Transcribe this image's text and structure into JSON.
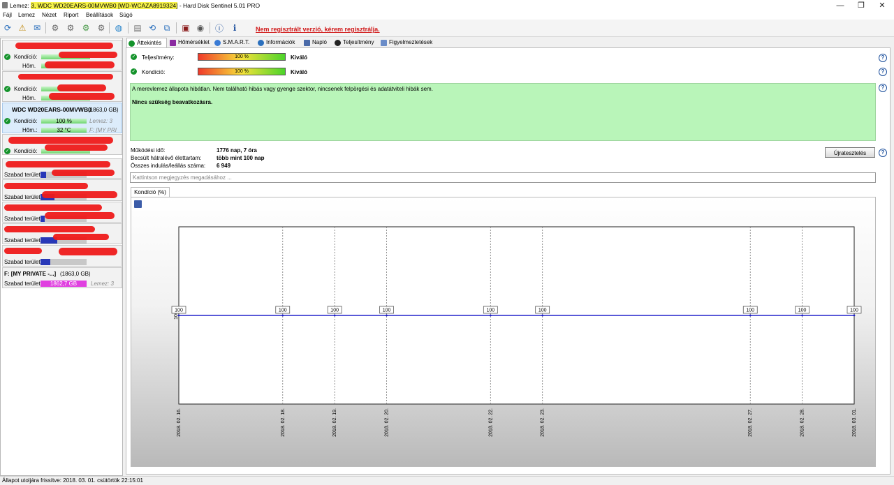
{
  "window": {
    "title_prefix": "Lemez: ",
    "title_disk": "3, WDC WD20EARS-00MVWB0 [WD-WCAZA8919324]",
    "title_app": " -  Hard Disk Sentinel 5.01 PRO",
    "min": "—",
    "max": "❐",
    "close": "✕"
  },
  "menu": [
    "Fájl",
    "Lemez",
    "Nézet",
    "Riport",
    "Beállítások",
    "Súgó"
  ],
  "toolbar": {
    "unregistered": "Nem regisztrált verzió, kérem regisztrálja."
  },
  "left": {
    "disks": [
      {
        "k_label": "Kondíció:",
        "h_label": "Hőm."
      },
      {
        "k_label": "Kondíció:",
        "h_label": "Hőm."
      },
      {
        "name": "WDC WD20EARS-00MVWB0",
        "size": "(1863,0 GB)",
        "k_label": "Kondíció:",
        "k_value": "100 %",
        "k_extra": "Lemez: 3",
        "h_label": "Hőm.:",
        "h_value": "32 °C",
        "h_extra": "F: [MY PRI"
      },
      {
        "k_label": "Kondíció:"
      }
    ],
    "volumes": [
      {
        "label": "Szabad terület"
      },
      {
        "label": "Szabad terület"
      },
      {
        "label": "Szabad terület"
      },
      {
        "label": "Szabad terület"
      },
      {
        "label": "Szabad terület"
      },
      {
        "name": "F: [MY PRIVATE -...]",
        "size": "(1863,0 GB)",
        "label": "Szabad terület",
        "value": "1862,7 GB",
        "extra": "Lemez: 3"
      }
    ]
  },
  "tabs": [
    "Áttekintés",
    "Hőmérséklet",
    "S.M.A.R.T.",
    "Információk",
    "Napló",
    "Teljesítmény",
    "Figyelmeztetések"
  ],
  "overview": {
    "performance_label": "Teljesítmény:",
    "performance_value": "100 %",
    "performance_text": "Kiváló",
    "performance_pct": 100,
    "condition_label": "Kondíció:",
    "condition_value": "100 %",
    "condition_text": "Kiváló",
    "condition_pct": 100,
    "status_line": "A merevlemez állapota hibátlan. Nem található hibás vagy gyenge szektor, nincsenek felpörgési és adatátviteli hibák sem.",
    "status_action": "Nincs szükség beavatkozásra.",
    "uptime_label": "Működési idő:",
    "uptime_value": "1776 nap, 7 óra",
    "life_label": "Becsült hátralévő élettartam:",
    "life_value": "több mint 100 nap",
    "starts_label": "Összes indulás/leállás száma:",
    "starts_value": "6 949",
    "retest_button": "Újratesztelés",
    "note_placeholder": "Kattintson megjegyzés megadásához ...",
    "chart_tab": "Kondíció  (%)"
  },
  "chart_data": {
    "type": "line",
    "series": [
      {
        "values": [
          100,
          100,
          100,
          100,
          100,
          100,
          100,
          100,
          100
        ]
      }
    ],
    "x": [
      "2018. 02. 16.",
      "2018. 02. 18.",
      "2018. 02. 19.",
      "2018. 02. 20.",
      "2018. 02. 22.",
      "2018. 02. 23.",
      "2018. 02. 27.",
      "2018. 02. 28.",
      "2018. 03. 01."
    ],
    "y_tick": "100",
    "grid": true,
    "line_color": "#2222cc"
  },
  "status": {
    "text": "Állapot utoljára frissítve: 2018. 03. 01. csütörtök 22:15:01"
  }
}
